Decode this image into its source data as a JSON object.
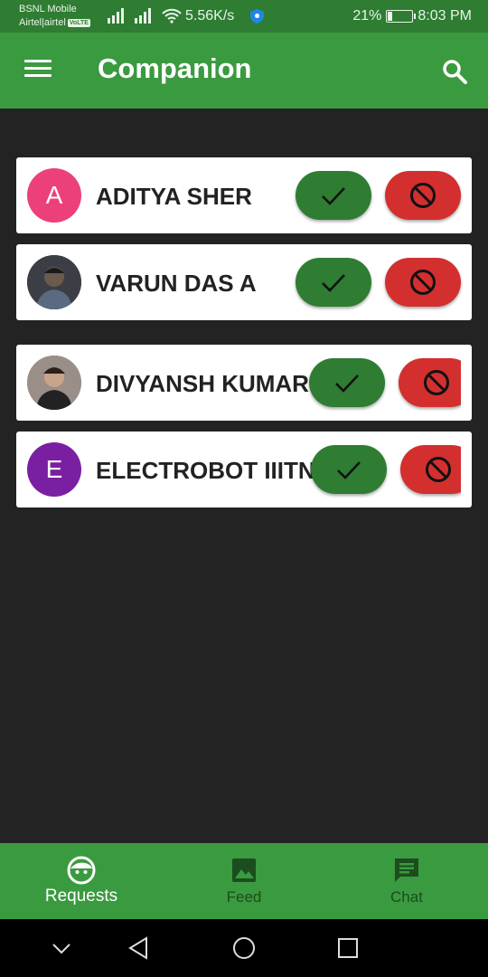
{
  "status_bar": {
    "carrier_line1": "BSNL Mobile",
    "carrier_line2": "Airtel|airtel",
    "volte": "VoLTE",
    "speed": "5.56K/s",
    "battery_pct": "21%",
    "battery_level": 0.21,
    "time": "8:03 PM"
  },
  "app_bar": {
    "title": "Companion"
  },
  "requests": [
    {
      "name": "ADITYA SHER",
      "initial": "A",
      "avatar_color": "#ec407a"
    },
    {
      "name": "VARUN DAS A",
      "initial": "",
      "avatar_color": "#3b3f45"
    },
    {
      "name": "DIVYANSH KUMAR",
      "initial": "",
      "avatar_color": "#9a8f88"
    },
    {
      "name": "ELECTROBOT IIITN",
      "initial": "E",
      "avatar_color": "#7b1fa2"
    }
  ],
  "bottom_nav": {
    "requests_label": "Requests",
    "feed_label": "Feed",
    "chat_label": "Chat"
  },
  "colors": {
    "primary": "#3a9a3f",
    "primary_dark": "#2e7d32",
    "accept": "#2e7d32",
    "reject": "#d32f2f",
    "background": "#232323"
  }
}
